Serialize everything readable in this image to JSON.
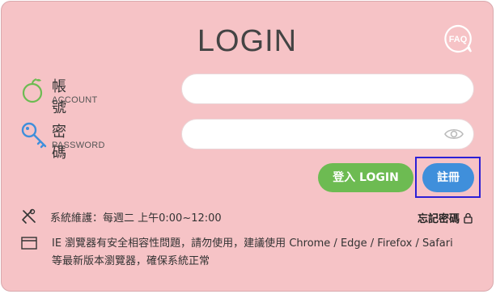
{
  "title": "LOGIN",
  "faq_label": "FAQ",
  "account": {
    "label": "帳號",
    "sublabel": "ACCOUNT",
    "value": ""
  },
  "password": {
    "label": "密碼",
    "sublabel": "PASSWORD",
    "value": ""
  },
  "buttons": {
    "login": "登入 LOGIN",
    "register": "註冊"
  },
  "maintenance": "系統維護：每週二 上午0:00~12:00",
  "forgot_password": "忘記密碼",
  "notice_line1": "IE 瀏覽器有安全相容性問題，請勿使用，建議使用 Chrome / Edge / Firefox / Safari",
  "notice_line2": "等最新版本瀏覽器，確保系統正常",
  "colors": {
    "background": "#f6c3c6",
    "login_button": "#6dbb52",
    "register_button": "#3f8fdb",
    "focus_outline": "#2c1fd6"
  }
}
